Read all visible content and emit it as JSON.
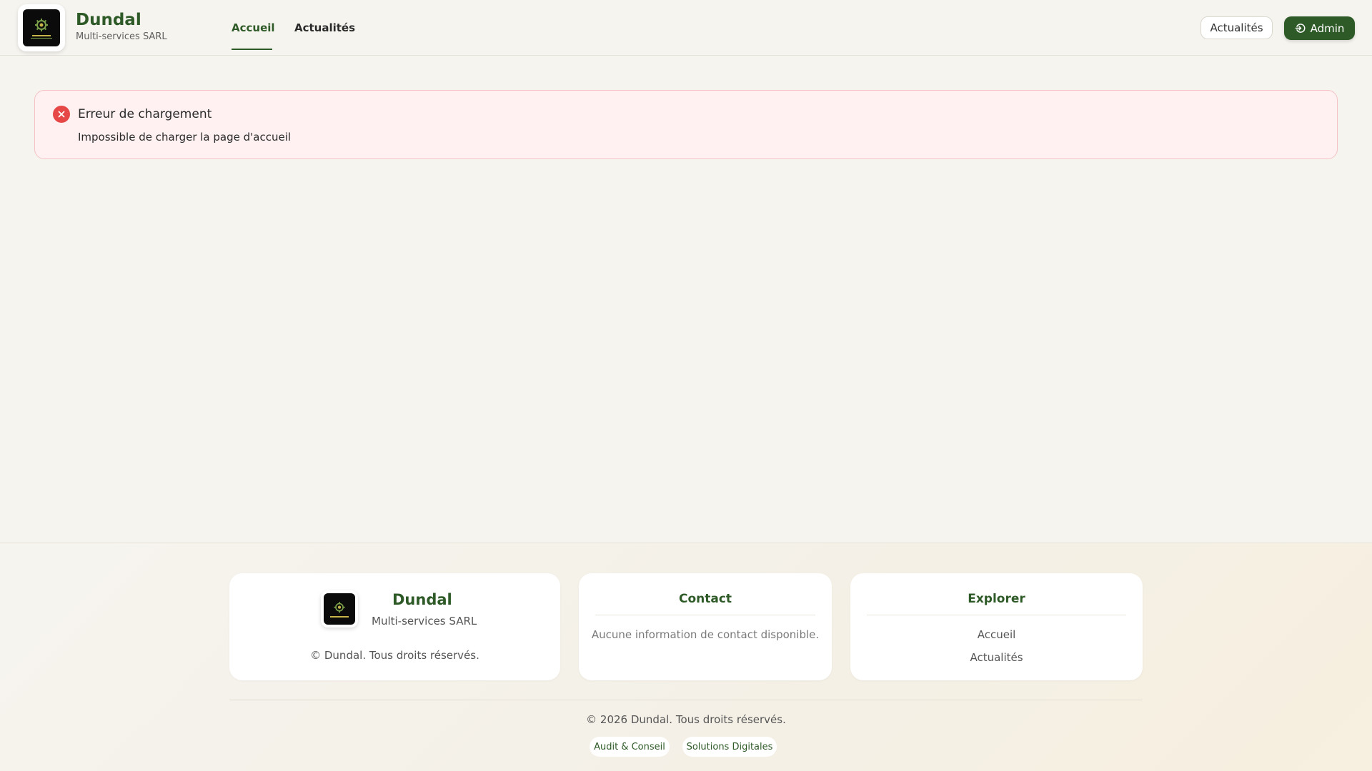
{
  "header": {
    "brand_name": "Dundal",
    "brand_sub": "Multi-services SARL",
    "nav": [
      {
        "label": "Accueil",
        "active": true
      },
      {
        "label": "Actualités",
        "active": false
      }
    ],
    "actualites_button": "Actualités",
    "admin_button": "Admin",
    "admin_icon": "login-icon"
  },
  "alert": {
    "icon": "error-x-icon",
    "title": "Erreur de chargement",
    "message": "Impossible de charger la page d'accueil"
  },
  "footer": {
    "brand_card": {
      "name": "Dundal",
      "sub": "Multi-services SARL",
      "copyright": "© Dundal. Tous droits réservés."
    },
    "contact_card": {
      "title": "Contact",
      "text": "Aucune information de contact disponible."
    },
    "explorer_card": {
      "title": "Explorer",
      "links": [
        "Accueil",
        "Actualités"
      ]
    },
    "copyright": "© 2026 Dundal. Tous droits réservés.",
    "pills": [
      "Audit & Conseil",
      "Solutions Digitales"
    ]
  },
  "colors": {
    "brand_green": "#2e5a27",
    "background": "#f6f4ef",
    "alert_bg": "#fff1f1",
    "alert_border": "#f4c2c4",
    "error_red": "#e64747"
  }
}
